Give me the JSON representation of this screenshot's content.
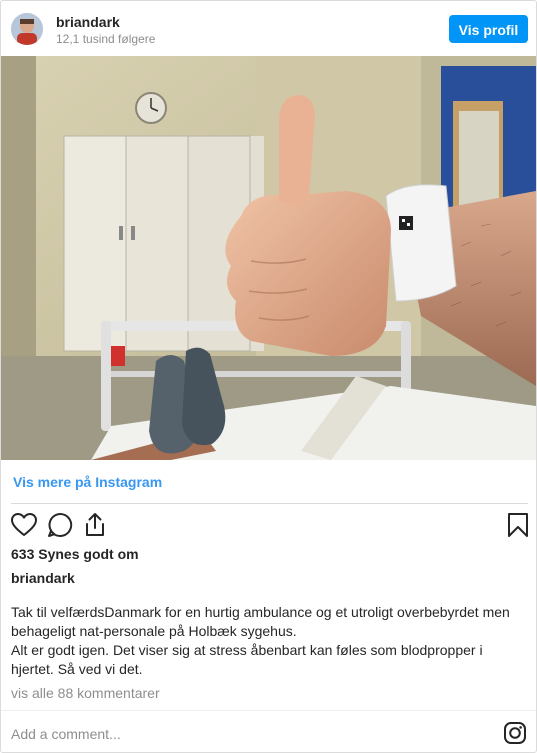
{
  "header": {
    "username": "briandark",
    "followers": "12,1 tusind følgere",
    "profile_button": "Vis profil"
  },
  "media": {
    "alt": "Thumbs up from hospital bed with wristband"
  },
  "see_more_link": "Vis mere på Instagram",
  "actions": {
    "icons": [
      "heart-icon",
      "comment-icon",
      "share-icon",
      "bookmark-icon"
    ]
  },
  "likes": "633 Synes godt om",
  "caption": {
    "username": "briandark",
    "lines": [
      "Tak til velfærdsDanmark for en hurtig ambulance og et utroligt overbebyrdet men",
      "behageligt nat-personale på Holbæk sygehus.",
      "Alt er godt igen. Det viser sig at stress åbenbart kan føles som blodpropper i",
      "hjertet. Så ved vi det."
    ]
  },
  "view_comments": "vis alle 88 kommentarer",
  "comment_placeholder": "Add a comment...",
  "colors": {
    "accent": "#0095f6",
    "link": "#3897f0",
    "muted": "#8e8e8e",
    "text": "#262626",
    "border": "#dbdbdb"
  }
}
